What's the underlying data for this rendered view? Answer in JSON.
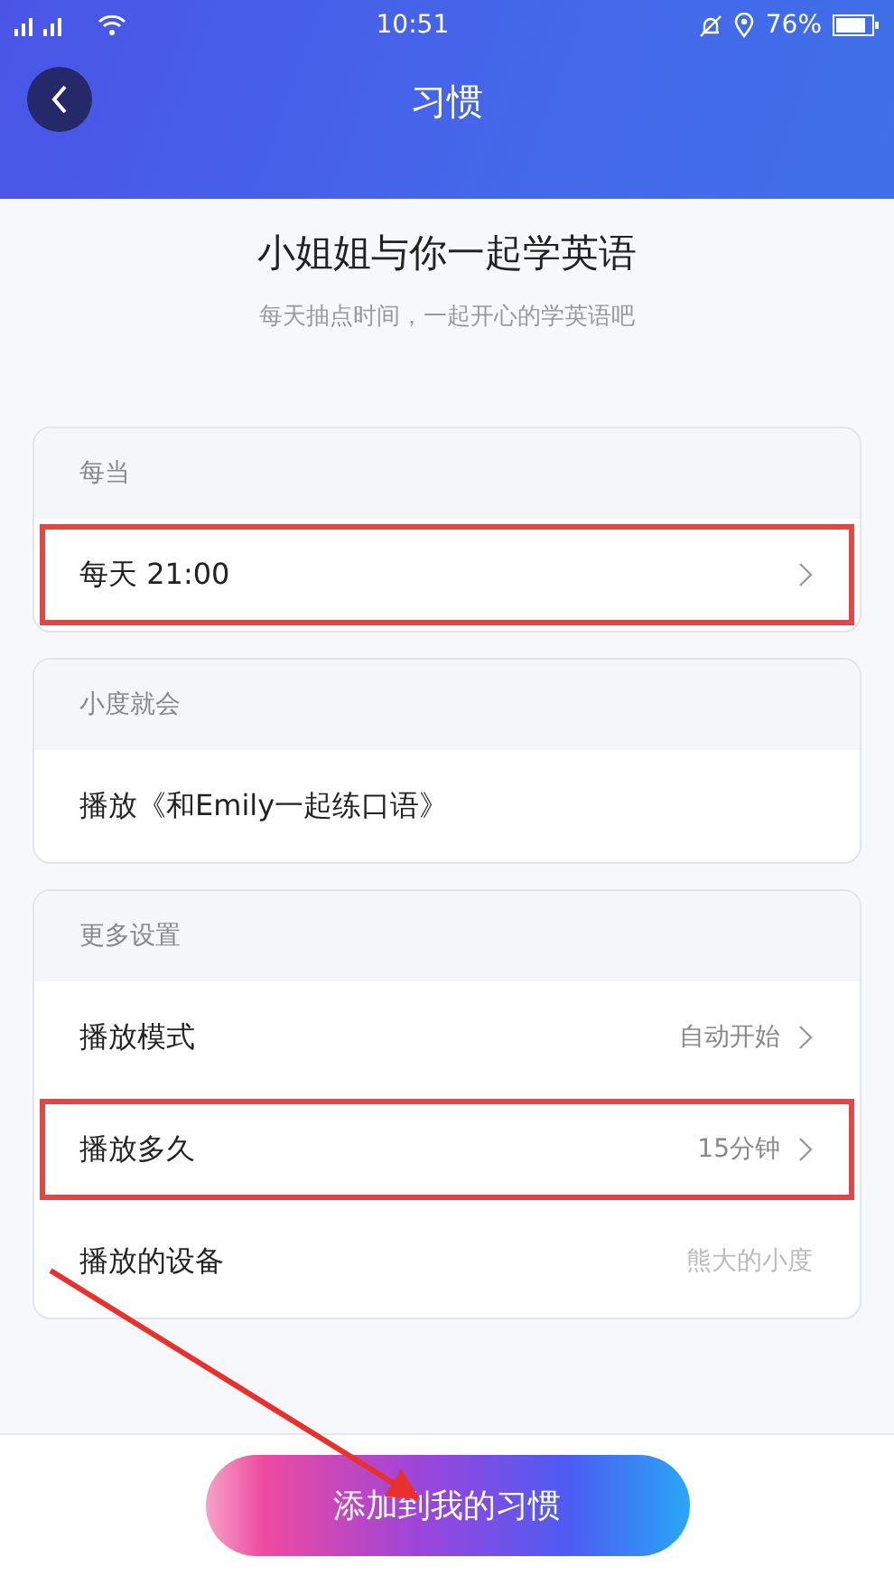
{
  "status_bar": {
    "time": "10:51",
    "battery": "76%"
  },
  "header": {
    "title": "习惯"
  },
  "intro": {
    "title": "小姐姐与你一起学英语",
    "subtitle": "每天抽点时间，一起开心的学英语吧"
  },
  "sections": [
    {
      "heading": "每当",
      "rows": [
        {
          "label": "每天 21:00",
          "chevron": true,
          "highlighted": true
        }
      ]
    },
    {
      "heading": "小度就会",
      "rows": [
        {
          "label": "播放《和Emily一起练口语》",
          "chevron": false,
          "highlighted": false
        }
      ]
    },
    {
      "heading": "更多设置",
      "rows": [
        {
          "label": "播放模式",
          "value": "自动开始",
          "chevron": true,
          "highlighted": false
        },
        {
          "label": "播放多久",
          "value": "15分钟",
          "chevron": true,
          "highlighted": true
        },
        {
          "label": "播放的设备",
          "value": "熊大的小度",
          "chevron": false,
          "highlighted": false
        }
      ]
    }
  ],
  "primary_button": {
    "label": "添加到我的习惯"
  }
}
